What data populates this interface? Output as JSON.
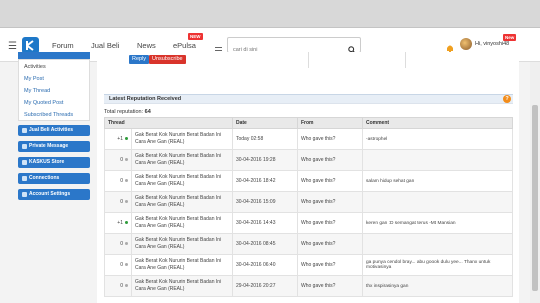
{
  "nav": {
    "links": [
      "Forum",
      "Jual Beli",
      "News",
      "ePulsa"
    ],
    "new_badge": "NEW",
    "search_placeholder": "cari di sini",
    "username": "Hi, vinyoshi48",
    "new_badge_user": "New"
  },
  "sidebar": {
    "items": [
      "Activities",
      "My Post",
      "My Thread",
      "My Quoted Post",
      "Subscribed Threads"
    ],
    "buttons": [
      "Jual Beli Activities",
      "Private Message",
      "KASKUS Store",
      "Connections",
      "Account Settings"
    ]
  },
  "actions": {
    "reply": "Reply",
    "unsubscribe": "Unsubscribe"
  },
  "panel": {
    "title": "Latest Reputation Received",
    "total_label": "Total reputation:",
    "total_value": "64",
    "help": "?"
  },
  "table": {
    "headers": [
      "Thread",
      "Date",
      "From",
      "Comment"
    ],
    "rows": [
      {
        "points": "+1",
        "dot": "#2e9b3a",
        "thread": "Gak Berat Kok Nururin Berat Badan Ini Cara Ane Gan (REAL)",
        "date": "Today 02:58",
        "from": "Who gave this?",
        "comment": "-astrophel"
      },
      {
        "points": "0",
        "dot": "#aaaaaa",
        "thread": "Gak Berat Kok Nururin Berat Badan Ini Cara Ane Gan (REAL)",
        "date": "30-04-2016 19:28",
        "from": "Who gave this?",
        "comment": ""
      },
      {
        "points": "0",
        "dot": "#aaaaaa",
        "thread": "Gak Berat Kok Nururin Berat Badan Ini Cara Ane Gan (REAL)",
        "date": "30-04-2016 18:42",
        "from": "Who gave this?",
        "comment": "salam hidup sehat gan"
      },
      {
        "points": "0",
        "dot": "#aaaaaa",
        "thread": "Gak Berat Kok Nururin Berat Badan Ini Cara Ane Gan (REAL)",
        "date": "30-04-2016 15:09",
        "from": "Who gave this?",
        "comment": ""
      },
      {
        "points": "+1",
        "dot": "#2e9b3a",
        "thread": "Gak Berat Kok Nururin Berat Badan Ini Cara Ane Gan (REAL)",
        "date": "30-04-2016 14:43",
        "from": "Who gave this?",
        "comment": "keren gan :D semangat terus -Mt Mansian"
      },
      {
        "points": "0",
        "dot": "#aaaaaa",
        "thread": "Gak Berat Kok Nururin Berat Badan Ini Cara Ane Gan (REAL)",
        "date": "30-04-2016 08:45",
        "from": "Who gave this?",
        "comment": ""
      },
      {
        "points": "0",
        "dot": "#aaaaaa",
        "thread": "Gak Berat Kok Nururin Berat Badan Ini Cara Ane Gan (REAL)",
        "date": "30-04-2016 06:40",
        "from": "Who gave this?",
        "comment": "ga punya cendol bray... abu goook dulu yee... Thanx untuk motivasinya"
      },
      {
        "points": "0",
        "dot": "#aaaaaa",
        "thread": "Gak Berat Kok Nururin Berat Badan Ini Cara Ane Gan (REAL)",
        "date": "29-04-2016 20:27",
        "from": "Who gave this?",
        "comment": "thx inspirasinya gan"
      }
    ]
  },
  "colors": {
    "primary": "#2b77c9",
    "reply": "#2b77c9",
    "unsubscribe": "#d9342b",
    "help": "#f28c1a"
  },
  "icons": [
    "hamburger-icon",
    "kaskus-logo-icon",
    "menu-icon",
    "search-icon",
    "notification-icon",
    "avatar",
    "help-icon"
  ]
}
